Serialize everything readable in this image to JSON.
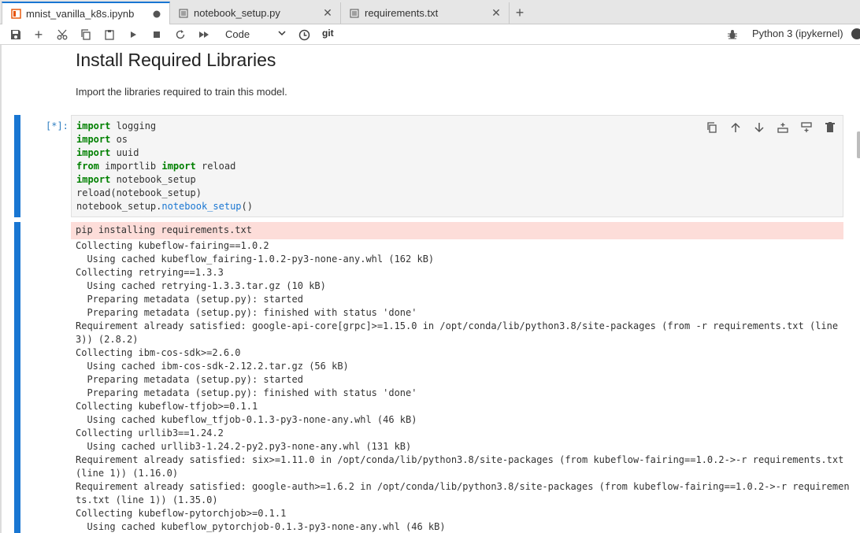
{
  "tabs": [
    {
      "label": "mnist_vanilla_k8s.ipynb",
      "icon": "notebook-icon",
      "active": true,
      "dirty": true
    },
    {
      "label": "notebook_setup.py",
      "icon": "file-icon",
      "active": false
    },
    {
      "label": "requirements.txt",
      "icon": "file-icon",
      "active": false
    }
  ],
  "toolbar": {
    "cell_type": "Code",
    "git_label": "git",
    "kernel_name": "Python 3 (ipykernel)"
  },
  "notebook": {
    "heading": "Install Required Libraries",
    "description": "Import the libraries required to train this model.",
    "prompt": "[*]:",
    "code_lines": [
      {
        "parts": [
          {
            "t": "import",
            "c": "kw"
          },
          {
            "t": " logging",
            "c": ""
          }
        ]
      },
      {
        "parts": [
          {
            "t": "import",
            "c": "kw"
          },
          {
            "t": " os",
            "c": ""
          }
        ]
      },
      {
        "parts": [
          {
            "t": "import",
            "c": "kw"
          },
          {
            "t": " uuid",
            "c": ""
          }
        ]
      },
      {
        "parts": [
          {
            "t": "from",
            "c": "kw"
          },
          {
            "t": " importlib ",
            "c": ""
          },
          {
            "t": "import",
            "c": "kw"
          },
          {
            "t": " reload",
            "c": ""
          }
        ]
      },
      {
        "parts": [
          {
            "t": "import",
            "c": "kw"
          },
          {
            "t": " notebook_setup",
            "c": ""
          }
        ]
      },
      {
        "parts": [
          {
            "t": "reload(notebook_setup)",
            "c": ""
          }
        ]
      },
      {
        "parts": [
          {
            "t": "notebook_setup.",
            "c": ""
          },
          {
            "t": "notebook_setup",
            "c": "fn"
          },
          {
            "t": "()",
            "c": ""
          }
        ]
      }
    ],
    "stderr_line": "pip installing requirements.txt",
    "output_lines": [
      "Collecting kubeflow-fairing==1.0.2",
      "  Using cached kubeflow_fairing-1.0.2-py3-none-any.whl (162 kB)",
      "Collecting retrying==1.3.3",
      "  Using cached retrying-1.3.3.tar.gz (10 kB)",
      "  Preparing metadata (setup.py): started",
      "  Preparing metadata (setup.py): finished with status 'done'",
      "Requirement already satisfied: google-api-core[grpc]>=1.15.0 in /opt/conda/lib/python3.8/site-packages (from -r requirements.txt (line",
      "3)) (2.8.2)",
      "Collecting ibm-cos-sdk>=2.6.0",
      "  Using cached ibm-cos-sdk-2.12.2.tar.gz (56 kB)",
      "  Preparing metadata (setup.py): started",
      "  Preparing metadata (setup.py): finished with status 'done'",
      "Collecting kubeflow-tfjob>=0.1.1",
      "  Using cached kubeflow_tfjob-0.1.3-py3-none-any.whl (46 kB)",
      "Collecting urllib3==1.24.2",
      "  Using cached urllib3-1.24.2-py2.py3-none-any.whl (131 kB)",
      "Requirement already satisfied: six>=1.11.0 in /opt/conda/lib/python3.8/site-packages (from kubeflow-fairing==1.0.2->-r requirements.txt",
      "(line 1)) (1.16.0)",
      "Requirement already satisfied: google-auth>=1.6.2 in /opt/conda/lib/python3.8/site-packages (from kubeflow-fairing==1.0.2->-r requiremen",
      "ts.txt (line 1)) (1.35.0)",
      "Collecting kubeflow-pytorchjob>=0.1.1",
      "  Using cached kubeflow_pytorchjob-0.1.3-py3-none-any.whl (46 kB)"
    ]
  },
  "colors": {
    "accent": "#1976d2",
    "stderr_bg": "#fdddd9",
    "keyword": "#008000"
  }
}
